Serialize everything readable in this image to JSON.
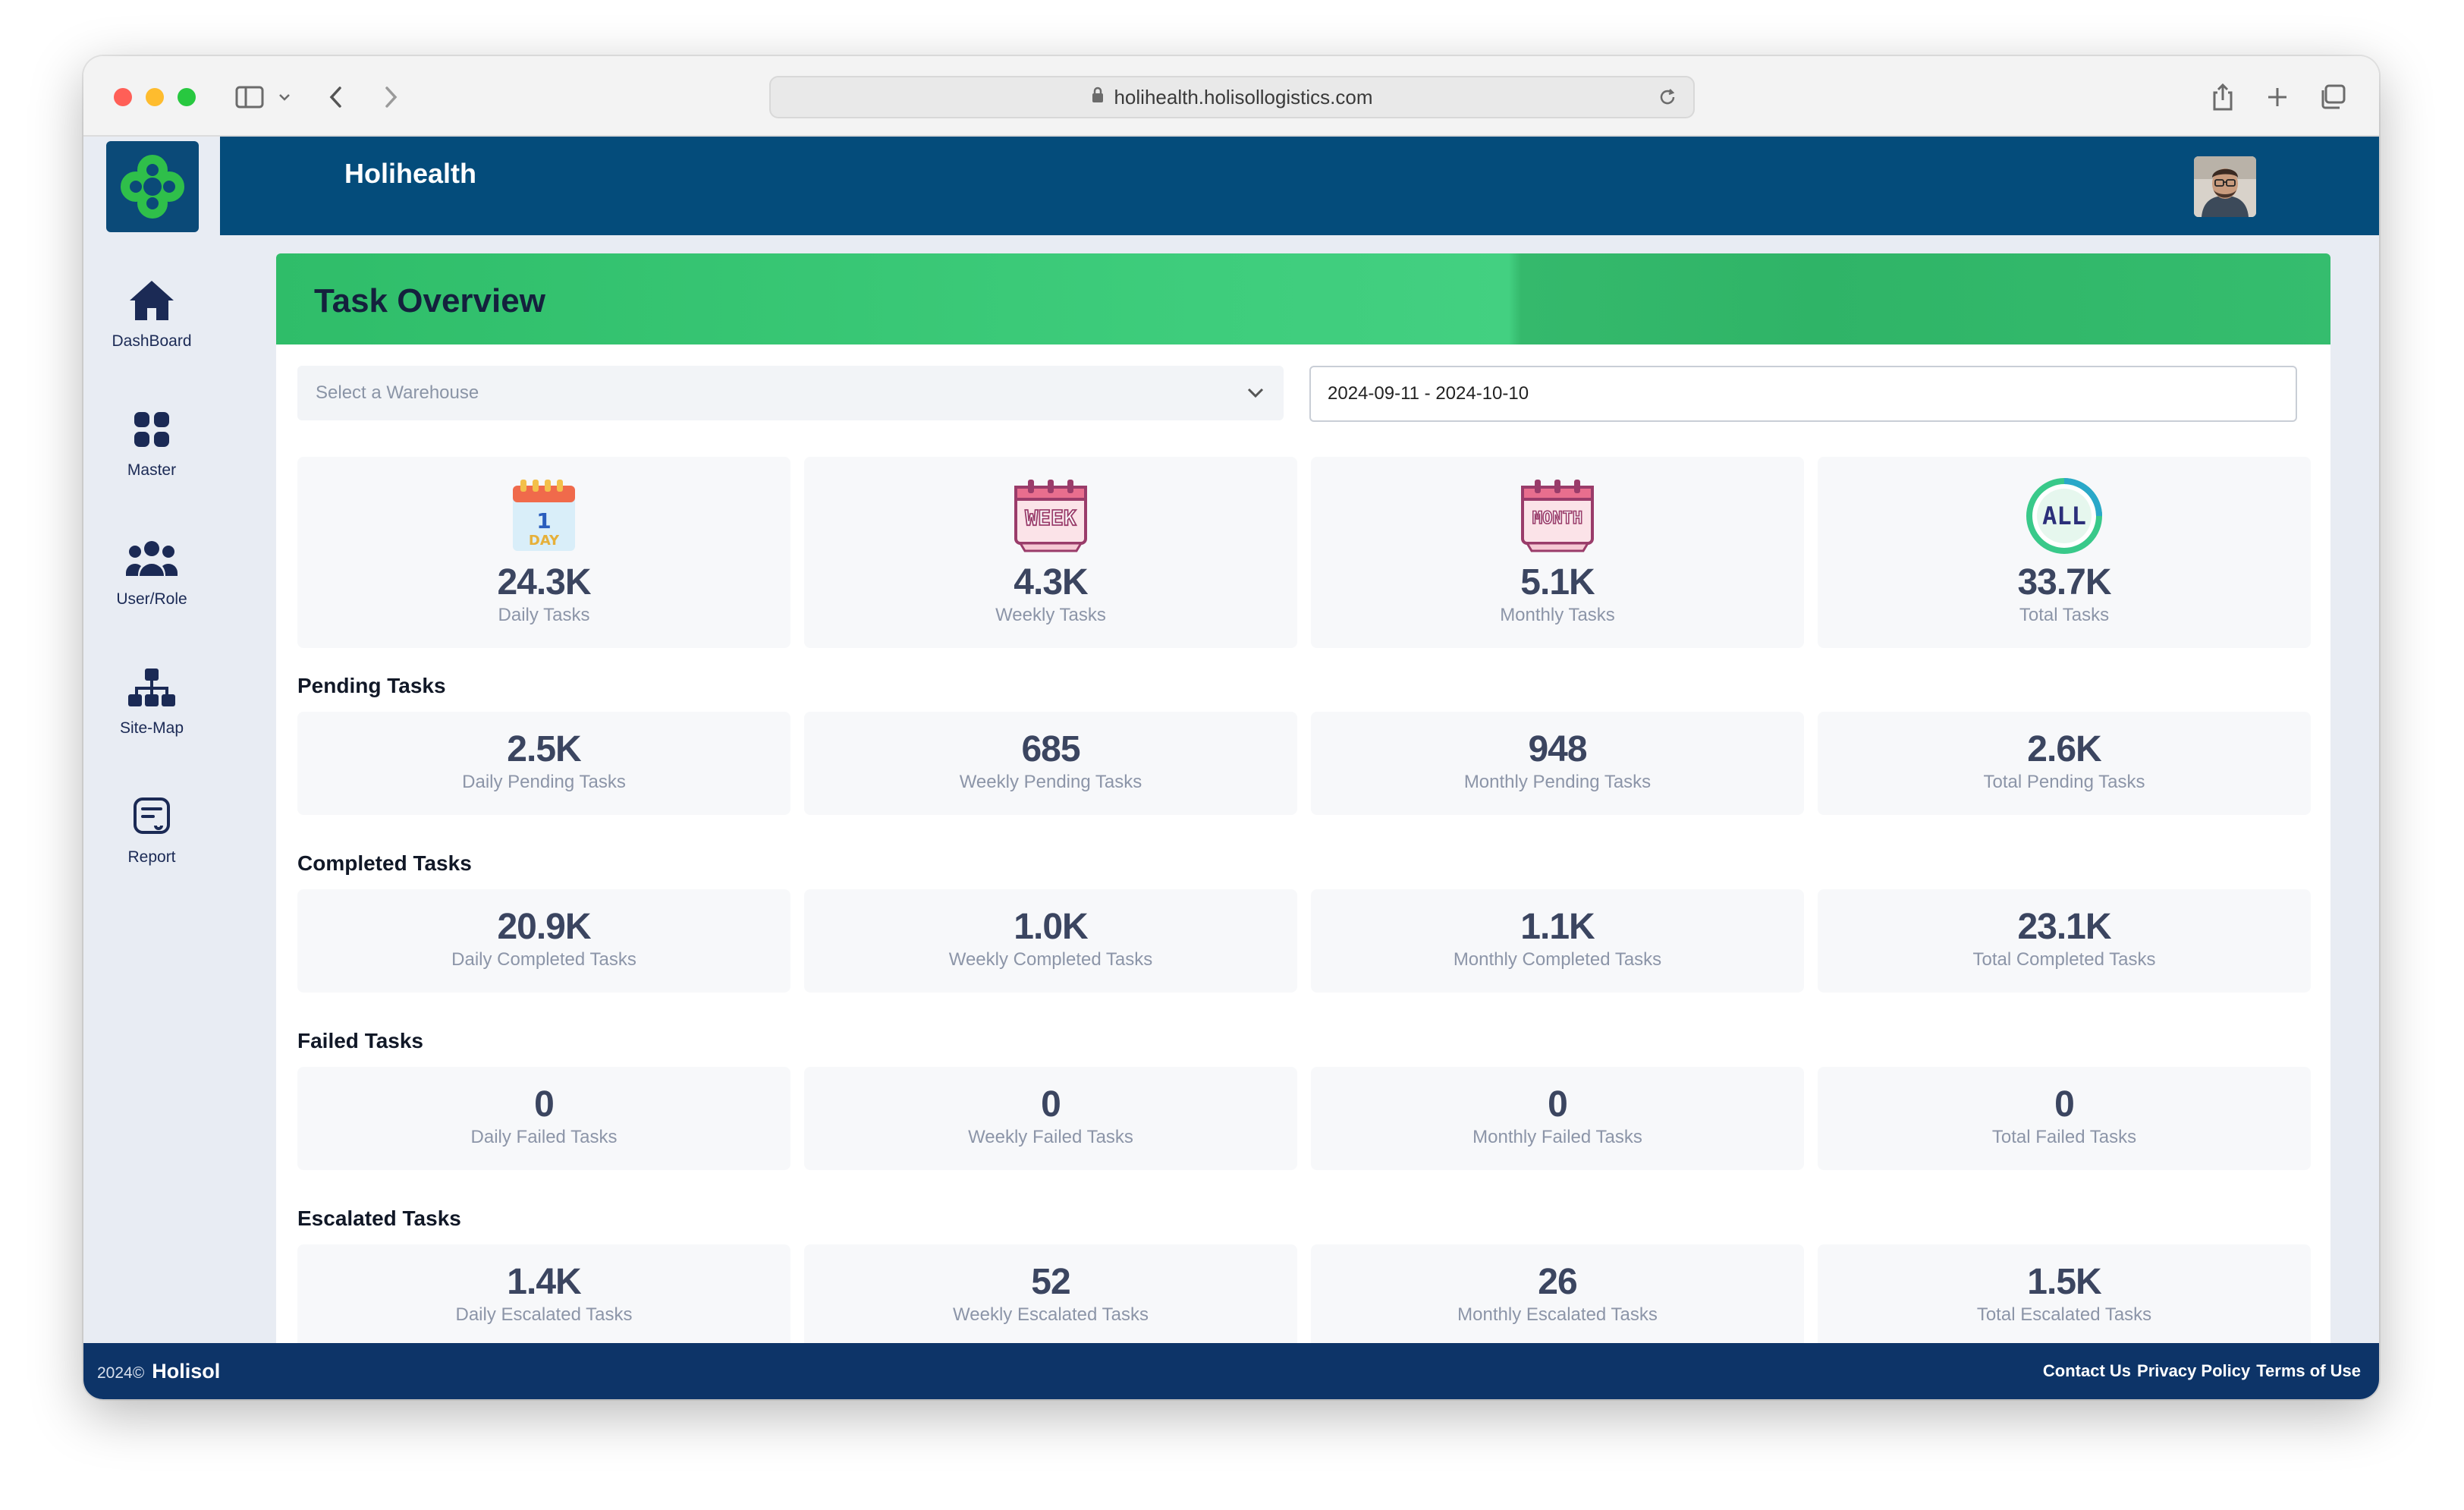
{
  "browser": {
    "url": "holihealth.holisollogistics.com"
  },
  "app": {
    "title": "Holihealth"
  },
  "sidebar": {
    "items": [
      {
        "label": "DashBoard",
        "icon": "home-icon"
      },
      {
        "label": "Master",
        "icon": "grid-icon"
      },
      {
        "label": "User/Role",
        "icon": "users-icon"
      },
      {
        "label": "Site-Map",
        "icon": "sitemap-icon"
      },
      {
        "label": "Report",
        "icon": "report-icon"
      }
    ]
  },
  "panel": {
    "title": "Task Overview",
    "warehouse_placeholder": "Select a Warehouse",
    "date_range": "2024-09-11 - 2024-10-10"
  },
  "overview": [
    {
      "value": "24.3K",
      "label": "Daily Tasks",
      "icon": "calendar-day-icon",
      "icon_text_top": "1",
      "icon_text_bottom": "DAY"
    },
    {
      "value": "4.3K",
      "label": "Weekly Tasks",
      "icon": "calendar-week-icon",
      "icon_text_top": "WEEK"
    },
    {
      "value": "5.1K",
      "label": "Monthly Tasks",
      "icon": "calendar-month-icon",
      "icon_text_top": "MONTH"
    },
    {
      "value": "33.7K",
      "label": "Total Tasks",
      "icon": "all-badge-icon",
      "icon_text_top": "ALL"
    }
  ],
  "sections": [
    {
      "title": "Pending Tasks",
      "cards": [
        {
          "value": "2.5K",
          "label": "Daily Pending Tasks"
        },
        {
          "value": "685",
          "label": "Weekly Pending Tasks"
        },
        {
          "value": "948",
          "label": "Monthly Pending Tasks"
        },
        {
          "value": "2.6K",
          "label": "Total Pending Tasks"
        }
      ]
    },
    {
      "title": "Completed Tasks",
      "cards": [
        {
          "value": "20.9K",
          "label": "Daily Completed Tasks"
        },
        {
          "value": "1.0K",
          "label": "Weekly Completed Tasks"
        },
        {
          "value": "1.1K",
          "label": "Monthly Completed Tasks"
        },
        {
          "value": "23.1K",
          "label": "Total Completed Tasks"
        }
      ]
    },
    {
      "title": "Failed Tasks",
      "cards": [
        {
          "value": "0",
          "label": "Daily Failed Tasks"
        },
        {
          "value": "0",
          "label": "Weekly Failed Tasks"
        },
        {
          "value": "0",
          "label": "Monthly Failed Tasks"
        },
        {
          "value": "0",
          "label": "Total Failed Tasks"
        }
      ]
    },
    {
      "title": "Escalated Tasks",
      "cards": [
        {
          "value": "1.4K",
          "label": "Daily Escalated Tasks"
        },
        {
          "value": "52",
          "label": "Weekly Escalated Tasks"
        },
        {
          "value": "26",
          "label": "Monthly Escalated Tasks"
        },
        {
          "value": "1.5K",
          "label": "Total Escalated Tasks"
        }
      ]
    }
  ],
  "footer": {
    "year": "2024©",
    "brand": "Holisol",
    "links": [
      "Contact Us",
      "Privacy Policy",
      "Terms of Use"
    ]
  },
  "colors": {
    "header_bg": "#044c7b",
    "footer_bg": "#0d3468",
    "panel_header_green": "#3ecd7c",
    "sidebar_bg": "#e8ecf3",
    "logo_green": "#2fbf4a"
  }
}
